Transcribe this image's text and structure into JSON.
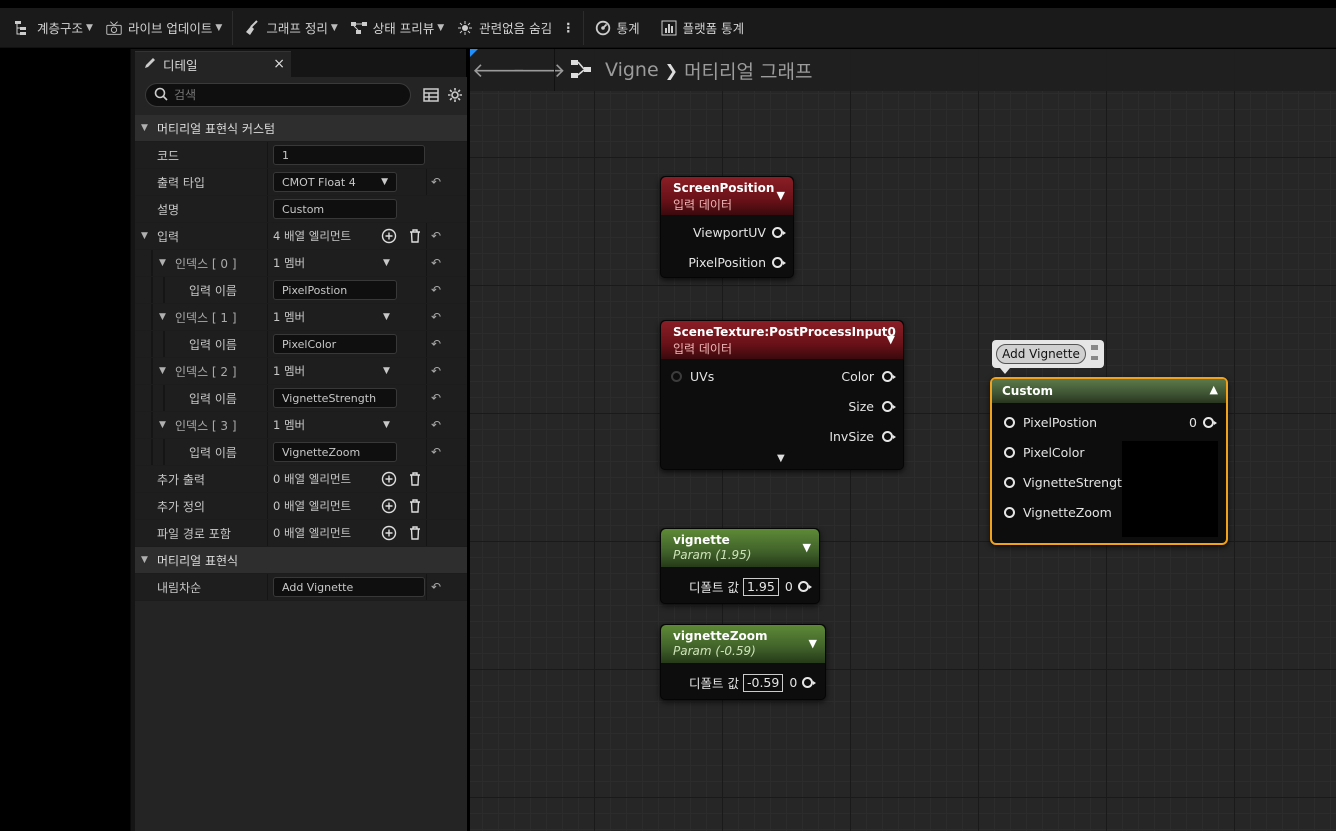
{
  "toolbar": {
    "items": [
      {
        "label": "계층구조",
        "icon": "hierarchy-icon"
      },
      {
        "label": "라이브 업데이트",
        "icon": "live-update-icon"
      },
      {
        "label": "그래프 정리",
        "icon": "broom-icon"
      },
      {
        "label": "상태 프리뷰",
        "icon": "state-preview-icon"
      },
      {
        "label": "관련없음 숨김",
        "icon": "hide-unrelated-icon"
      },
      {
        "label": "통계",
        "icon": "stats-icon"
      },
      {
        "label": "플랫폼 통계",
        "icon": "platform-stats-icon"
      }
    ]
  },
  "details": {
    "tab_label": "디테일",
    "search_placeholder": "검색",
    "sections": {
      "custom_title": "머티리얼 표현식 커스텀",
      "code_label": "코드",
      "code_value": "1",
      "output_type_label": "출력 타입",
      "output_type_value": "CMOT Float 4",
      "desc_label": "설명",
      "desc_value": "Custom",
      "inputs_label": "입력",
      "inputs_value": "4 배열 엘리먼트",
      "index0": "인덱스 [ 0 ]",
      "index1": "인덱스 [ 1 ]",
      "index2": "인덱스 [ 2 ]",
      "index3": "인덱스 [ 3 ]",
      "member": "1 멤버",
      "input_name_label": "입력 이름",
      "input0": "PixelPostion",
      "input1": "PixelColor",
      "input2": "VignetteStrength",
      "input3": "VignetteZoom",
      "extra_out_label": "추가 출력",
      "extra_def_label": "추가 정의",
      "include_label": "파일 경로 포함",
      "zero_elements": "0 배열 엘리먼트",
      "expr_title": "머티리얼 표현식",
      "desc2_label": "내림차순",
      "desc2_value": "Add Vignette"
    }
  },
  "graph": {
    "breadcrumb_root": "Vigne",
    "breadcrumb_child": "머티리얼 그래프",
    "nodes": {
      "screen": {
        "title": "ScreenPosition",
        "subtitle": "입력 데이터",
        "out1": "ViewportUV",
        "out2": "PixelPosition"
      },
      "scene": {
        "title": "SceneTexture:PostProcessInput0",
        "subtitle": "입력 데이터",
        "in1": "UVs",
        "out1": "Color",
        "out2": "Size",
        "out3": "InvSize"
      },
      "vignette": {
        "title": "vignette",
        "subtitle": "Param (1.95)",
        "label": "디폴트 값",
        "value": "1.95",
        "out": "0"
      },
      "zoom": {
        "title": "vignetteZoom",
        "subtitle": "Param (-0.59)",
        "label": "디폴트 값",
        "value": "-0.59",
        "out": "0"
      },
      "custom": {
        "title": "Custom",
        "in1": "PixelPostion",
        "in2": "PixelColor",
        "in3": "VignetteStrength",
        "in4": "VignetteZoom",
        "out": "0"
      },
      "comment": "Add Vignette"
    }
  }
}
